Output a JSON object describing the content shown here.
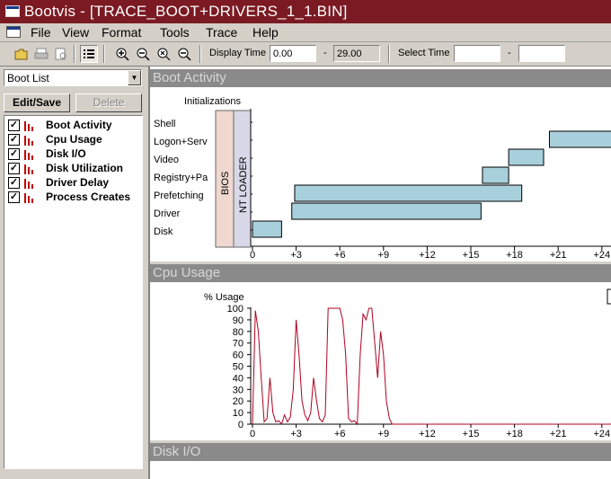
{
  "window": {
    "title": "Bootvis - [TRACE_BOOT+DRIVERS_1_1.BIN]"
  },
  "menu": [
    "File",
    "View",
    "Format",
    "Tools",
    "Trace",
    "Help"
  ],
  "toolbar": {
    "icons": [
      "open-folder-icon",
      "print-icon",
      "print-preview-icon",
      "list-view-icon",
      "zoom-in-icon",
      "zoom-out-icon",
      "zoom-full-icon",
      "zoom-selection-icon"
    ],
    "display_time_label": "Display Time",
    "display_time_start": "0.00",
    "display_time_end": "29.00",
    "select_time_label": "Select Time",
    "select_time_start": "",
    "select_time_end": "",
    "range_separator": "-"
  },
  "left_panel": {
    "list_select": "Boot List",
    "edit_save_label": "Edit/Save",
    "delete_label": "Delete",
    "graphs": [
      {
        "label": "Boot Activity",
        "checked": true
      },
      {
        "label": "Cpu Usage",
        "checked": true
      },
      {
        "label": "Disk I/O",
        "checked": true
      },
      {
        "label": "Disk Utilization",
        "checked": true
      },
      {
        "label": "Driver Delay",
        "checked": true
      },
      {
        "label": "Process Creates",
        "checked": true
      }
    ]
  },
  "boot_activity": {
    "title": "Boot Activity",
    "header_label": "Initializations",
    "rows": [
      "Shell",
      "Logon+Serv",
      "Video",
      "Registry+Pa",
      "Prefetching",
      "Driver",
      "Disk"
    ],
    "phases": [
      {
        "label": "BIOS",
        "color": "#f0d8d0"
      },
      {
        "label": "NT LOADER",
        "color": "#d8d8e8"
      }
    ],
    "bars": [
      {
        "row": "Disk",
        "start": 0.0,
        "end": 2.0
      },
      {
        "row": "Driver",
        "start": 2.7,
        "end": 15.7
      },
      {
        "row": "Prefetching",
        "start": 2.9,
        "end": 18.5
      },
      {
        "row": "Registry+Pa",
        "start": 15.8,
        "end": 17.6
      },
      {
        "row": "Video",
        "start": 17.6,
        "end": 20.0
      },
      {
        "row": "Logon+Serv",
        "start": 20.4,
        "end": 29.0
      }
    ],
    "bar_color": "#a8d0dc",
    "x_ticks": [
      "0",
      "+3",
      "+6",
      "+9",
      "+12",
      "+15",
      "+18",
      "+21",
      "+24"
    ]
  },
  "cpu_usage": {
    "title": "Cpu Usage",
    "y_label": "% Usage",
    "line_color": "#b00020"
  },
  "disk_io": {
    "title": "Disk I/O"
  },
  "chart_data": {
    "type": "line",
    "title": "Cpu Usage",
    "ylabel": "% Usage",
    "ylim": [
      0,
      100
    ],
    "y_ticks": [
      "0",
      "10",
      "20",
      "30",
      "40",
      "50",
      "60",
      "70",
      "80",
      "90",
      "100"
    ],
    "x_ticks": [
      "0",
      "+3",
      "+6",
      "+9",
      "+12",
      "+15",
      "+18",
      "+21",
      "+24"
    ],
    "x": [
      0.0,
      0.2,
      0.4,
      0.6,
      0.8,
      1.0,
      1.2,
      1.4,
      1.6,
      1.8,
      2.0,
      2.2,
      2.4,
      2.6,
      2.8,
      3.0,
      3.2,
      3.4,
      3.6,
      3.8,
      4.0,
      4.2,
      4.4,
      4.6,
      4.8,
      5.0,
      5.2,
      5.4,
      5.6,
      5.8,
      6.0,
      6.2,
      6.4,
      6.6,
      6.8,
      7.0,
      7.2,
      7.4,
      7.6,
      7.8,
      8.0,
      8.2,
      8.4,
      8.6,
      8.8,
      9.0,
      9.2,
      9.4,
      9.6,
      9.8,
      10.0,
      10.2,
      10.4,
      10.6,
      10.8,
      11.0,
      11.2,
      11.4,
      11.6,
      11.8,
      12.0,
      12.2,
      12.4,
      12.6,
      12.8,
      13.0,
      13.2,
      13.4,
      13.6,
      13.8,
      14.0,
      14.2,
      14.4,
      14.6,
      14.8,
      15.0,
      15.2,
      15.4,
      15.6,
      15.8,
      16.0,
      16.2,
      16.4,
      16.6,
      16.8,
      17.0,
      17.2,
      17.4,
      17.6,
      17.8,
      18.0,
      18.2,
      18.4,
      18.6,
      18.8,
      19.0,
      19.2,
      19.4,
      19.6,
      19.8,
      20.0,
      20.2,
      20.4,
      20.6,
      20.8,
      21.0,
      21.2,
      21.4,
      21.6,
      21.8,
      22.0,
      22.2,
      22.4,
      22.6,
      22.8,
      23.0,
      23.2,
      23.4,
      23.6,
      23.8,
      24.0,
      24.2,
      24.4,
      24.6,
      24.8,
      25.0
    ],
    "series": [
      {
        "values": [
          0,
          98,
          80,
          40,
          2,
          5,
          40,
          10,
          2,
          3,
          0,
          8,
          2,
          6,
          30,
          90,
          60,
          20,
          8,
          3,
          10,
          40,
          20,
          5,
          2,
          8,
          100,
          100,
          100,
          100,
          100,
          90,
          60,
          5,
          2,
          3,
          0,
          60,
          95,
          90,
          100,
          100,
          70,
          40,
          80,
          60,
          20,
          5,
          0,
          0,
          0,
          0,
          0,
          0,
          0,
          0,
          0,
          0,
          0,
          0,
          0,
          0,
          0,
          0,
          0,
          0,
          0,
          0,
          0,
          0,
          0,
          0,
          0,
          0,
          0,
          0,
          0,
          0,
          0,
          0,
          0,
          0,
          0,
          0,
          0,
          0,
          0,
          0,
          0,
          0,
          0,
          0,
          0,
          0,
          0,
          0,
          0,
          0,
          0,
          0,
          0,
          0,
          0,
          0,
          0,
          0,
          0,
          0,
          0,
          0,
          0,
          0,
          0,
          0,
          0,
          0,
          0,
          0,
          0,
          0,
          0,
          0,
          0,
          0,
          0,
          0
        ]
      }
    ]
  }
}
